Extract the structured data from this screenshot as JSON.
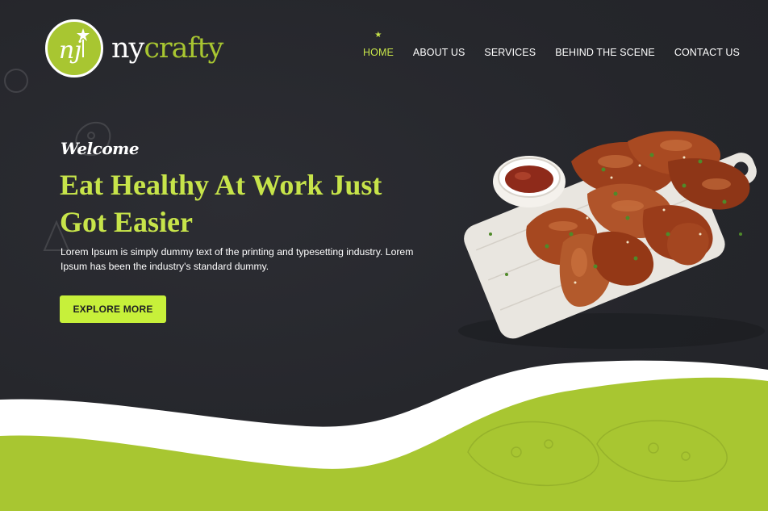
{
  "brand": {
    "logo_initials": "nj",
    "name_part1": "ny",
    "name_part2": "crafty"
  },
  "nav": {
    "items": [
      {
        "label": "HOME",
        "active": true
      },
      {
        "label": "ABOUT US",
        "active": false
      },
      {
        "label": "SERVICES",
        "active": false
      },
      {
        "label": "BEHIND THE SCENE",
        "active": false
      },
      {
        "label": "CONTACT US",
        "active": false
      }
    ],
    "active_marker": "★"
  },
  "hero": {
    "welcome": "Welcome",
    "headline_line1": "Eat Healthy At Work Just",
    "headline_line2": "Got Easier",
    "description": "Lorem Ipsum is simply dummy text of the printing and typesetting industry. Lorem Ipsum has been the industry's standard dummy.",
    "cta_label": "EXPLORE MORE"
  },
  "colors": {
    "background": "#26272d",
    "accent": "#a8c631",
    "accent_bright": "#c7e44a",
    "button": "#c7f03a",
    "text": "#ffffff"
  },
  "images": {
    "hero_food": "chicken-wings-on-board-with-sauce"
  }
}
